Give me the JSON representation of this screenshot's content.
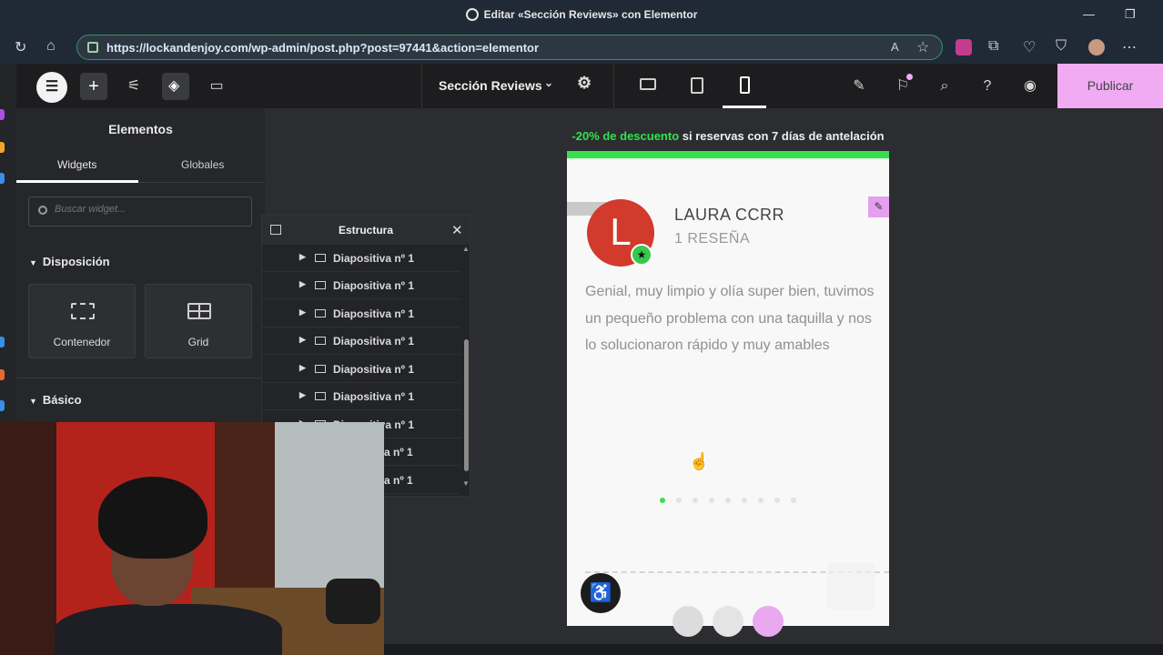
{
  "browser": {
    "window_title": "Editar «Sección Reviews» con Elementor",
    "url": "https://lockandenjoy.com/wp-admin/post.php?post=97441&action=elementor"
  },
  "topbar": {
    "document_title": "Sección Reviews",
    "publish_label": "Publicar"
  },
  "panel": {
    "title": "Elementos",
    "tabs": [
      "Widgets",
      "Globales"
    ],
    "search_placeholder": "Buscar widget...",
    "sections": {
      "layout": "Disposición",
      "basic": "Básico"
    },
    "widgets": [
      {
        "label": "Contenedor",
        "icon": "container-icon"
      },
      {
        "label": "Grid",
        "icon": "grid-icon"
      }
    ]
  },
  "structure": {
    "title": "Estructura",
    "rows": [
      "Diapositiva nº 1",
      "Diapositiva nº 1",
      "Diapositiva nº 1",
      "Diapositiva nº 1",
      "Diapositiva nº 1",
      "Diapositiva nº 1",
      "Diapositiva nº 1",
      "a nº 1",
      "a nº 1"
    ]
  },
  "preview": {
    "announcement_highlight": "-20% de descuento",
    "announcement_rest": " si reservas con 7 días de antelación",
    "avatar_letter": "L",
    "reviewer_name": "LAURA CCRR",
    "review_count": "1 RESEÑA",
    "review_text": "Genial, muy limpio y olía super bien, tuvimos un pequeño problema con una taquilla y nos lo solucionaron rápido y muy amables",
    "dot_count": 9,
    "active_dot": 0
  },
  "colors": {
    "accent_green": "#35e04e",
    "publish_pink": "#f0abf3",
    "avatar_red": "#d23a2c",
    "editor_dark": "#1d1d1f"
  }
}
